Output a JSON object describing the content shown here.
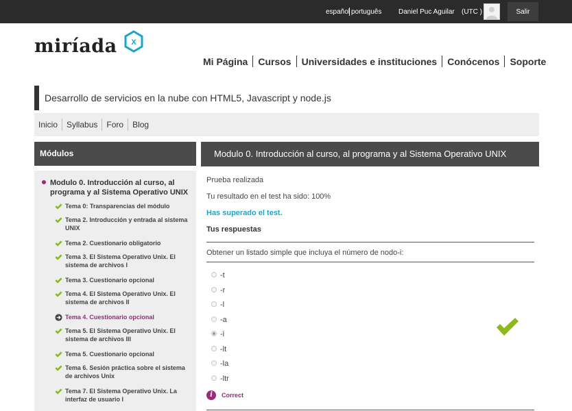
{
  "topbar": {
    "lang_es": "español",
    "lang_pt": "português",
    "user_name": "Daniel Puc Aguilar",
    "timezone": "(UTC )",
    "logout": "Salir"
  },
  "logo": {
    "text": "miríada",
    "badge": "X"
  },
  "mainnav": [
    "Mi Página",
    "Cursos",
    "Universidades e instituciones",
    "Conócenos",
    "Soporte"
  ],
  "course_title": "Desarrollo de servicios en la nube con HTML5, Javascript y node.js",
  "coursenav": [
    "Inicio",
    "Syllabus",
    "Foro",
    "Blog"
  ],
  "sidebar": {
    "header": "Módulos",
    "module_title": "Modulo 0. Introducción al curso, al programa y al Sistema Operativo UNIX",
    "lessons": [
      {
        "label": "Tema 0: Transparencias del módulo",
        "status": "done"
      },
      {
        "label": "Tema 2. Introducción y entrada al sistema UNIX",
        "status": "done"
      },
      {
        "label": "Tema 2. Cuestionario obligatorio",
        "status": "done"
      },
      {
        "label": "Tema 3. El Sistema Operativo Unix. El sistema de archivos I",
        "status": "done"
      },
      {
        "label": "Tema 3. Cuestionario opcional",
        "status": "done"
      },
      {
        "label": "Tema 4. El Sistema Operativo Unix. El sistema de archivos II",
        "status": "done"
      },
      {
        "label": "Tema 4. Cuestionario opcional",
        "status": "current"
      },
      {
        "label": "Tema 5. El Sistema Operativo Unix. El sistema de archivos III",
        "status": "done"
      },
      {
        "label": "Tema 5. Cuestionario opcional",
        "status": "done"
      },
      {
        "label": "Tema 6. Sesión práctica sobre el sistema de archivos Unix",
        "status": "done"
      },
      {
        "label": "Tema 7. El Sistema Operativo Unix. La interfaz de usuario I",
        "status": "done"
      }
    ]
  },
  "content": {
    "header": "Modulo 0. Introducción al curso, al programa y al Sistema Operativo UNIX",
    "status_text": "Prueba realizada",
    "result_text": "Tu resultado en el test ha sido: 100%",
    "passed_text": "Has superado el test.",
    "answers_title": "Tus respuestas",
    "question": "Obtener un listado simple que incluya el número de nodo-i:",
    "options": [
      "-t",
      "-r",
      "-l",
      "-a",
      "-i",
      "-lt",
      "-la",
      "-ltr"
    ],
    "selected_option": "-i",
    "feedback": "Correct"
  },
  "colors": {
    "accent_purple": "#9b2a7c",
    "check_green": "#8db81e",
    "link_blue": "#1aa5c8",
    "dark_bar": "#2b2b2b",
    "header_gray": "#4b4b4b"
  }
}
